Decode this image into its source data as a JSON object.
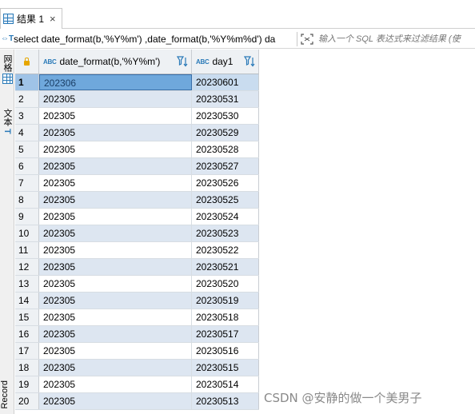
{
  "tabbar": {
    "tab_label": "结果 1",
    "close_glyph": "×"
  },
  "filterbar": {
    "sql_icon": "⇔T",
    "sql_text": "select date_format(b,'%Y%m') ,date_format(b,'%Y%m%d') da",
    "filter_placeholder": "输入一个 SQL 表达式来过滤结果 (使"
  },
  "leftstrip": {
    "grid_label": "网格",
    "text_icon": "T",
    "text_label": "文本",
    "record_label": "Record"
  },
  "grid": {
    "columns": [
      {
        "type_icon": "ABC",
        "label": "date_format(b,'%Y%m')"
      },
      {
        "type_icon": "ABC",
        "label": "day1"
      }
    ],
    "rows": [
      {
        "num": "1",
        "c1": "202306",
        "c2": "20230601"
      },
      {
        "num": "2",
        "c1": "202305",
        "c2": "20230531"
      },
      {
        "num": "3",
        "c1": "202305",
        "c2": "20230530"
      },
      {
        "num": "4",
        "c1": "202305",
        "c2": "20230529"
      },
      {
        "num": "5",
        "c1": "202305",
        "c2": "20230528"
      },
      {
        "num": "6",
        "c1": "202305",
        "c2": "20230527"
      },
      {
        "num": "7",
        "c1": "202305",
        "c2": "20230526"
      },
      {
        "num": "8",
        "c1": "202305",
        "c2": "20230525"
      },
      {
        "num": "9",
        "c1": "202305",
        "c2": "20230524"
      },
      {
        "num": "10",
        "c1": "202305",
        "c2": "20230523"
      },
      {
        "num": "11",
        "c1": "202305",
        "c2": "20230522"
      },
      {
        "num": "12",
        "c1": "202305",
        "c2": "20230521"
      },
      {
        "num": "13",
        "c1": "202305",
        "c2": "20230520"
      },
      {
        "num": "14",
        "c1": "202305",
        "c2": "20230519"
      },
      {
        "num": "15",
        "c1": "202305",
        "c2": "20230518"
      },
      {
        "num": "16",
        "c1": "202305",
        "c2": "20230517"
      },
      {
        "num": "17",
        "c1": "202305",
        "c2": "20230516"
      },
      {
        "num": "18",
        "c1": "202305",
        "c2": "20230515"
      },
      {
        "num": "19",
        "c1": "202305",
        "c2": "20230514"
      },
      {
        "num": "20",
        "c1": "202305",
        "c2": "20230513"
      }
    ]
  },
  "watermark": "CSDN @安静的做一个美男子",
  "colors": {
    "accent": "#2a7ab8",
    "selected_cell": "#6fa8dc",
    "alt_row": "#dde6f1"
  }
}
